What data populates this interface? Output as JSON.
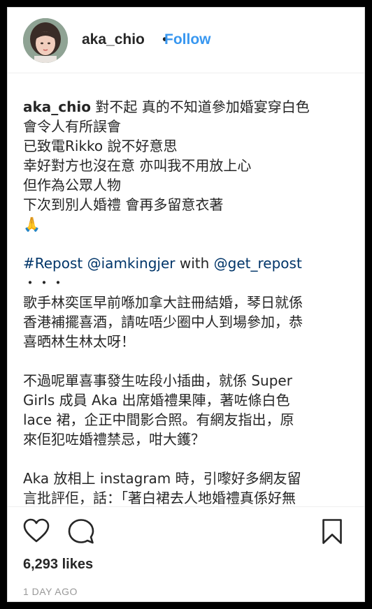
{
  "header": {
    "username": "aka_chio",
    "separator": "•",
    "follow_label": "Follow"
  },
  "caption": {
    "username": "aka_chio",
    "first_line": "對不起 真的不知道參加婚宴穿白色",
    "lines": [
      "會令人有所誤會",
      "已致電Rikko 說不好意思",
      "幸好對方也沒在意 亦叫我不用放上心",
      "但作為公眾人物",
      "下次到別人婚禮 會再多留意衣著",
      "🙏"
    ],
    "repost": {
      "hashtag": "#Repost",
      "mention1": "@iamkingjer",
      "with_text": " with ",
      "mention2": "@get_repost"
    },
    "dots": "・・・",
    "paragraph1": [
      "歌手林奕匡早前喺加拿大註冊結婚，琴日就係",
      "香港補擺喜酒，請咗唔少圈中人到場參加，恭",
      "喜晒林生林太呀！"
    ],
    "paragraph2": [
      "不過呢單喜事發生咗段小插曲，就係 Super",
      "Girls 成員 Aka 出席婚禮果陣，著咗條白色",
      "lace 裙，企正中間影合照。有網友指出，原",
      "來佢犯咗婚禮禁忌，咁大鑊？"
    ],
    "paragraph3": [
      "Aka 放相上 instagram 時，引嚟好多網友留",
      "言批評佢，話：「著白裙去人地婚禮真係好無"
    ]
  },
  "actions": {
    "like_icon": "heart-icon",
    "comment_icon": "comment-icon",
    "save_icon": "bookmark-icon"
  },
  "likes": "6,293 likes",
  "timestamp": "1 DAY AGO",
  "colors": {
    "follow": "#3897f0",
    "link": "#003569",
    "text": "#262626",
    "muted": "#999999"
  }
}
